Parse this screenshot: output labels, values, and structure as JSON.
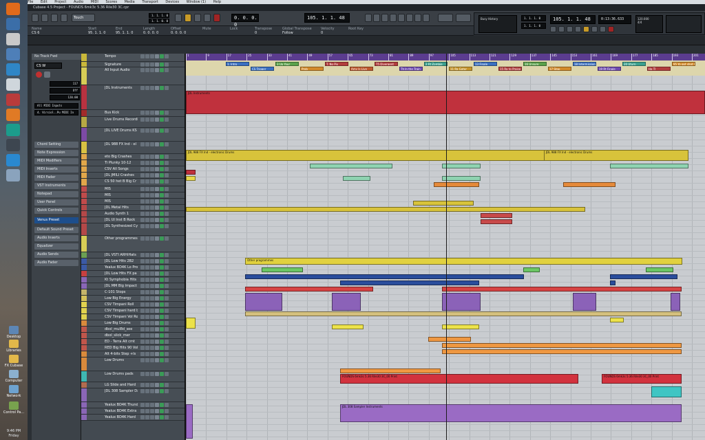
{
  "taskbar": {
    "desktop_items": [
      {
        "label": "Desktop"
      },
      {
        "label": "Libraries"
      },
      {
        "label": "FX Cubase"
      },
      {
        "label": "Computer"
      },
      {
        "label": "Network"
      },
      {
        "label": "Control Pa..."
      }
    ],
    "clock_time": "9:46 PM",
    "clock_day": "Friday"
  },
  "menu": [
    "File",
    "Edit",
    "Project",
    "Audio",
    "MIDI",
    "Scores",
    "Media",
    "Transport",
    "Devices",
    "Window (1)",
    "Help"
  ],
  "window_title": "Cubase 4.5 Project - FOUNDS 6mk3c 5.36 Rile30 3C.cpr",
  "toolbar": {
    "automation_mode": "Touch",
    "position_lcd": "1. 1. 1. 0",
    "position_lcd2": "1. 1. 0. 0",
    "main_lcd": "105. 1. 1. 48",
    "secondary_lcd": "0. 0. 0. 0"
  },
  "transport": {
    "time_display": "105. 1. 1. 48",
    "timecode": "0:13:36.633",
    "tempo_label": "Busy History",
    "tempo_value": "120.000",
    "signature": "4/4",
    "left_locator": "1. 1. 1. 0",
    "right_locator": "1. 1. 1. 0"
  },
  "infoline": {
    "headers": [
      "Name",
      "Start",
      "End",
      "Length",
      "Offset",
      "Mute",
      "Lock",
      "Transpose",
      "Global Transpose",
      "Velocity",
      "Root Key"
    ],
    "values": [
      "CS 6",
      "95. 1. 1. 0",
      "95. 1. 1. 0",
      "0. 0. 0. 0",
      "0. 0. 0. 0",
      "",
      "",
      "0",
      "Follow",
      "0",
      ""
    ]
  },
  "inspector": {
    "header": "No Track Fwd",
    "track_name": "CS W",
    "volume_value": "117",
    "pan_value": "Off",
    "tempo_field": "120.00",
    "input": "All MIDI Inputs",
    "output": "4. Virsiol..Pu MIDI In",
    "sections": [
      "Chord Setting",
      "Note Expression",
      "MIDI Modifiers",
      "MIDI Inserts",
      "MIDI Fader",
      "VST Instruments",
      "Notepad",
      "User Panel",
      "Quick Controls"
    ],
    "preset": "Venus Preset",
    "extra_sections": [
      "Default Sound Preset",
      "Audio Inserts",
      "Equalizer",
      "Audio Sends",
      "Audio Fader"
    ]
  },
  "tracks": [
    {
      "num": "",
      "name": "Tempo"
    },
    {
      "num": "",
      "name": "Signature"
    },
    {
      "num": "",
      "name": "All Input Audio"
    },
    {
      "num": "",
      "name": "JDL Instruments"
    },
    {
      "num": "",
      "name": "Bus Kick"
    },
    {
      "num": "",
      "name": "Live Drums Recordi"
    },
    {
      "num": "",
      "name": "JDL LIVE Drums KS"
    },
    {
      "num": "",
      "name": "JDL 988 FX Ind - el"
    },
    {
      "num": "",
      "name": "eto Big Crashes"
    },
    {
      "num": "",
      "name": "Ti Plunky 10-12"
    },
    {
      "num": "",
      "name": "CSV All Songs"
    },
    {
      "num": "",
      "name": "JDL JMILI Crashes"
    },
    {
      "num": "",
      "name": "CS 50 het B Big Cr"
    },
    {
      "num": "",
      "name": "MIS"
    },
    {
      "num": "",
      "name": "MIS"
    },
    {
      "num": "",
      "name": "MIS"
    },
    {
      "num": "",
      "name": "JDL Metal Hits"
    },
    {
      "num": "",
      "name": "Audio Synth 1"
    },
    {
      "num": "",
      "name": "JDL UI Inst B Rock"
    },
    {
      "num": "",
      "name": "JDL Synthesized Cy"
    },
    {
      "num": "",
      "name": "Other programmes"
    },
    {
      "num": "",
      "name": "JDL VSTI ARHiHats"
    },
    {
      "num": "",
      "name": "JDL Low Hits 2B2"
    },
    {
      "num": "",
      "name": "Yealux BD4K Lo Pro"
    },
    {
      "num": "",
      "name": "JDL Low Hits FX pa"
    },
    {
      "num": "",
      "name": "Kt Symphobia Hits"
    },
    {
      "num": "",
      "name": "JDL MM Big Impact"
    },
    {
      "num": "",
      "name": "C-101 Stops"
    },
    {
      "num": "",
      "name": "Low Big Energy"
    },
    {
      "num": "",
      "name": "CSV Timpani Roll"
    },
    {
      "num": "",
      "name": "CSV Timpani hard b"
    },
    {
      "num": "",
      "name": "CSV Timpani Vol Ro"
    },
    {
      "num": "",
      "name": "Low Big Drums"
    },
    {
      "num": "",
      "name": "dbol_mul8d_see"
    },
    {
      "num": "",
      "name": "dbol_slick_mer"
    },
    {
      "num": "",
      "name": "ED - Terra Alt cmt"
    },
    {
      "num": "",
      "name": "RED Big Hits 90 Vol"
    },
    {
      "num": "",
      "name": "Alt 4-bits Step +ls"
    },
    {
      "num": "",
      "name": "Low Drums"
    },
    {
      "num": "",
      "name": "Low Drums pads"
    },
    {
      "num": "",
      "name": "LG Slide and Hard"
    },
    {
      "num": "",
      "name": "JDL 308 Sampler Da"
    },
    {
      "num": "",
      "name": "Yealux BD4K Thund"
    },
    {
      "num": "",
      "name": "Yealux BD4K Extra"
    },
    {
      "num": "",
      "name": "Yealux BD4K Hard"
    }
  ],
  "ruler": [
    "1",
    "9",
    "17",
    "25",
    "33",
    "41",
    "49",
    "57",
    "65",
    "73",
    "81",
    "89",
    "97",
    "105",
    "113",
    "121",
    "129",
    "137",
    "145",
    "153",
    "161",
    "169",
    "177",
    "185",
    "193",
    "201"
  ],
  "markers": [
    {
      "label": "1. Intro"
    },
    {
      "label": "CS Trigger"
    },
    {
      "label": "3 Up Your"
    },
    {
      "label": "Prob"
    },
    {
      "label": "T. No Pix"
    },
    {
      "label": "Amy Is Live"
    },
    {
      "label": "T5 Divergent"
    },
    {
      "label": "Th In the Train"
    },
    {
      "label": "2 Rt Zombie"
    },
    {
      "label": "11 Ra Gator"
    },
    {
      "label": "13 Finale"
    },
    {
      "label": "15 Ra to Praise"
    },
    {
      "label": "16 Unsure"
    },
    {
      "label": "17 Stop"
    },
    {
      "label": "18 Intermission"
    },
    {
      "label": "19 Rt Finale"
    },
    {
      "label": "20 Uturn"
    },
    {
      "label": "Ha TI"
    },
    {
      "label": "95 Yo got shot Rep Music"
    }
  ],
  "events": [
    {
      "label": "JDL Instruments"
    },
    {
      "label": "JDL 988 FX Ind - electronic Drums"
    },
    {
      "label": "JDL 988 FX Ind - electronic Drums"
    },
    {
      "label": "Other programmes"
    },
    {
      "label": "FOUNDS 6mk3c 5.36 Rile30 3C_00 Print"
    },
    {
      "label": "FOUNDS 6mk3c 5.36 Rile30 3C_00 Print"
    },
    {
      "label": "JDL 308 Sampler Instruments"
    }
  ]
}
